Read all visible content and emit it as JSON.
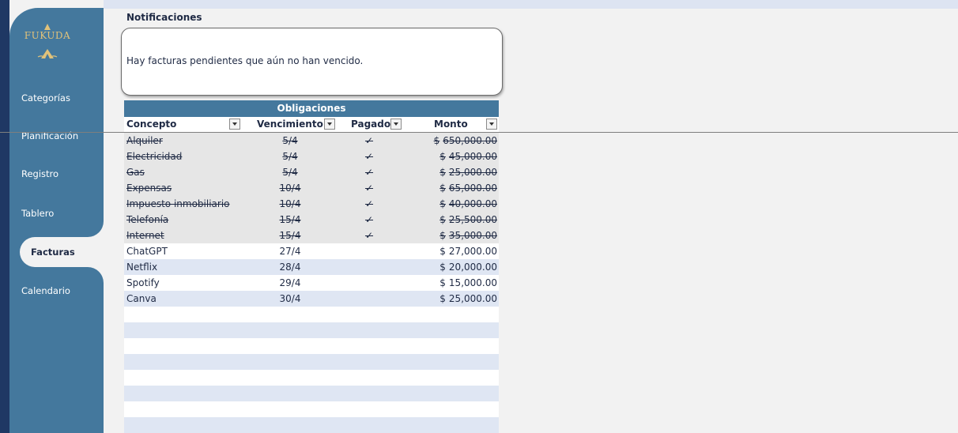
{
  "sidebar": {
    "logo_text": "FUKUDA",
    "items": [
      {
        "label": "Categorías"
      },
      {
        "label": "Planificación"
      },
      {
        "label": "Registro"
      },
      {
        "label": "Tablero"
      },
      {
        "label": "Facturas"
      },
      {
        "label": "Calendario"
      }
    ],
    "active": "Facturas"
  },
  "notifications": {
    "title": "Notificaciones",
    "message": "Hay facturas pendientes que aún no han vencido."
  },
  "table": {
    "title": "Obligaciones",
    "headers": [
      "Concepto",
      "Vencimiento",
      "Pagado",
      "Monto"
    ],
    "rows": [
      {
        "concepto": "Alquiler",
        "vencimiento": "5/4",
        "pagado": "✓",
        "monto": "650,000.00",
        "paid": true
      },
      {
        "concepto": "Electricidad",
        "vencimiento": "5/4",
        "pagado": "✓",
        "monto": "45,000.00",
        "paid": true
      },
      {
        "concepto": "Gas",
        "vencimiento": "5/4",
        "pagado": "✓",
        "monto": "25,000.00",
        "paid": true
      },
      {
        "concepto": "Expensas",
        "vencimiento": "10/4",
        "pagado": "✓",
        "monto": "65,000.00",
        "paid": true
      },
      {
        "concepto": "Impuesto inmobiliario",
        "vencimiento": "10/4",
        "pagado": "✓",
        "monto": "40,000.00",
        "paid": true
      },
      {
        "concepto": "Telefonía",
        "vencimiento": "15/4",
        "pagado": "✓",
        "monto": "25,500.00",
        "paid": true
      },
      {
        "concepto": "Internet",
        "vencimiento": "15/4",
        "pagado": "✓",
        "monto": "35,000.00",
        "paid": true
      },
      {
        "concepto": "ChatGPT",
        "vencimiento": "27/4",
        "pagado": "",
        "monto": "27,000.00",
        "paid": false
      },
      {
        "concepto": "Netflix",
        "vencimiento": "28/4",
        "pagado": "",
        "monto": "20,000.00",
        "paid": false
      },
      {
        "concepto": "Spotify",
        "vencimiento": "29/4",
        "pagado": "",
        "monto": "15,000.00",
        "paid": false
      },
      {
        "concepto": "Canva",
        "vencimiento": "30/4",
        "pagado": "",
        "monto": "25,000.00",
        "paid": false
      }
    ],
    "currency_symbol": "$",
    "empty_rows": 8
  },
  "colors": {
    "sidebar": "#44789d",
    "edge": "#1f3864",
    "table_header": "#44789d",
    "row_alt": "#dfe6f3",
    "paid_row": "#e6e6e6",
    "logo_gold": "#e1c27a"
  }
}
